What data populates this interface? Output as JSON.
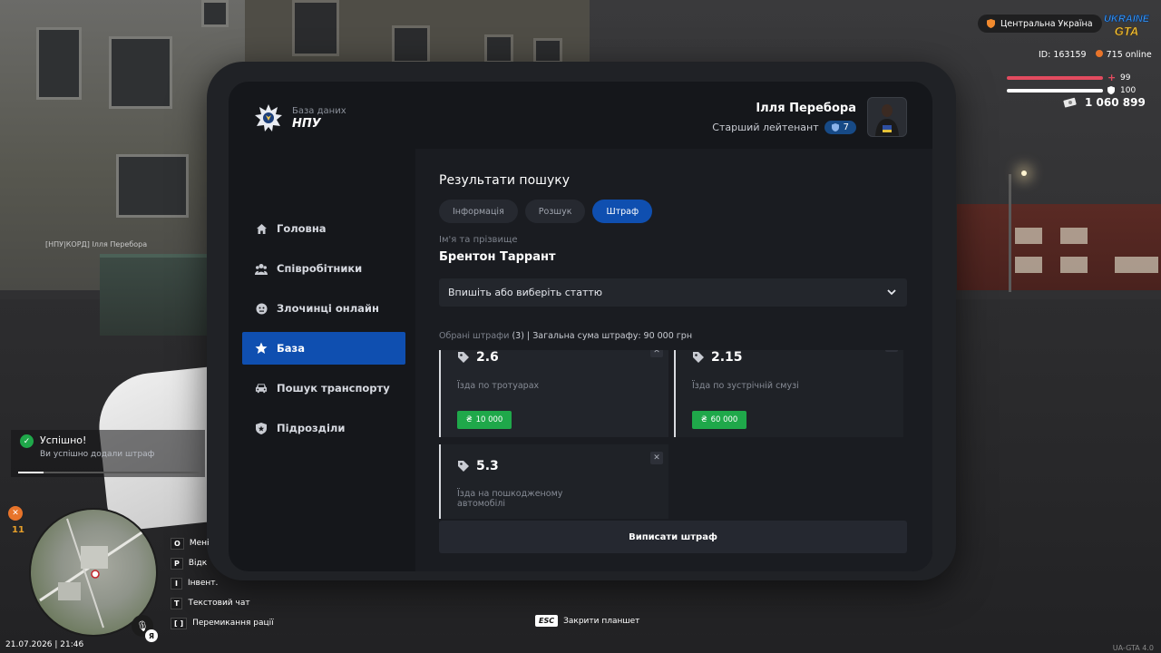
{
  "tablet": {
    "brand": {
      "subtitle": "База даних",
      "title": "НПУ"
    },
    "user": {
      "name": "Ілля Перебора",
      "rank": "Старший лейтенант",
      "level": "7"
    },
    "nav": [
      {
        "label": "Головна",
        "icon": "home-icon"
      },
      {
        "label": "Співробітники",
        "icon": "people-icon"
      },
      {
        "label": "Злочинці онлайн",
        "icon": "criminal-face-icon"
      },
      {
        "label": "База",
        "icon": "star-icon",
        "active": true
      },
      {
        "label": "Пошук транспорту",
        "icon": "car-icon"
      },
      {
        "label": "Підрозділи",
        "icon": "shield-star-icon"
      }
    ],
    "content": {
      "title": "Результати пошуку",
      "tabs": [
        "Інформація",
        "Розшук",
        "Штраф"
      ],
      "active_tab": "Штраф",
      "name_label": "Ім'я та прізвище",
      "person_name": "Брентон Таррант",
      "select_placeholder": "Впишіть або виберіть статтю",
      "summary_prefix": "Обрані штрафи",
      "summary_count": "(3)",
      "summary_total": "| Загальна сума штрафу: 90 000 грн",
      "fines": [
        {
          "article": "2.6",
          "description": "Їзда по тротуарах",
          "price": "10 000"
        },
        {
          "article": "2.15",
          "description": "Їзда по зустрічній смузі",
          "price": "60 000"
        },
        {
          "article": "5.3",
          "description": "Їзда на пошкодженому автомобілі"
        }
      ],
      "currency_symbol": "₴",
      "submit_label": "Виписати штраф"
    }
  },
  "hud": {
    "region": "Центральна Україна",
    "game_logo_top": "UKRAINE",
    "game_logo_bottom": "GTA",
    "player_id": "ID: 163159",
    "online": "715 online",
    "health": "99",
    "armor": "100",
    "money": "1 060 899",
    "toast": {
      "title": "Успішно!",
      "text": "Ви успішно додали штраф"
    },
    "food": "11",
    "keybinds": [
      {
        "key": "O",
        "label": "Мені"
      },
      {
        "key": "P",
        "label": "Відк"
      },
      {
        "key": "I",
        "label": "Інвент."
      },
      {
        "key": "T",
        "label": "Текстовий чат"
      },
      {
        "key": "[ ]",
        "label": "Перемикання рації"
      }
    ],
    "mic_key": "Я",
    "datetime": "21.07.2026 | 21:46",
    "esc_key": "ESC",
    "esc_label": "Закрити планшет",
    "version": "UA-GTA 4.0",
    "nametag": "[НПУ|КОРД] Ілля Перебора"
  },
  "colors": {
    "accent": "#0f4fb0",
    "price": "#1fa84a",
    "health": "#e34b5f",
    "food": "#e8742a"
  }
}
